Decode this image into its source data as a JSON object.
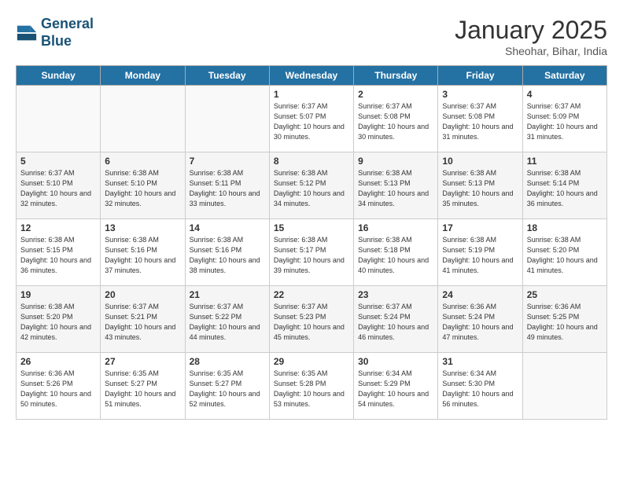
{
  "header": {
    "logo_line1": "General",
    "logo_line2": "Blue",
    "month": "January 2025",
    "location": "Sheohar, Bihar, India"
  },
  "days_of_week": [
    "Sunday",
    "Monday",
    "Tuesday",
    "Wednesday",
    "Thursday",
    "Friday",
    "Saturday"
  ],
  "weeks": [
    [
      {
        "day": "",
        "sunrise": "",
        "sunset": "",
        "daylight": ""
      },
      {
        "day": "",
        "sunrise": "",
        "sunset": "",
        "daylight": ""
      },
      {
        "day": "",
        "sunrise": "",
        "sunset": "",
        "daylight": ""
      },
      {
        "day": "1",
        "sunrise": "Sunrise: 6:37 AM",
        "sunset": "Sunset: 5:07 PM",
        "daylight": "Daylight: 10 hours and 30 minutes."
      },
      {
        "day": "2",
        "sunrise": "Sunrise: 6:37 AM",
        "sunset": "Sunset: 5:08 PM",
        "daylight": "Daylight: 10 hours and 30 minutes."
      },
      {
        "day": "3",
        "sunrise": "Sunrise: 6:37 AM",
        "sunset": "Sunset: 5:08 PM",
        "daylight": "Daylight: 10 hours and 31 minutes."
      },
      {
        "day": "4",
        "sunrise": "Sunrise: 6:37 AM",
        "sunset": "Sunset: 5:09 PM",
        "daylight": "Daylight: 10 hours and 31 minutes."
      }
    ],
    [
      {
        "day": "5",
        "sunrise": "Sunrise: 6:37 AM",
        "sunset": "Sunset: 5:10 PM",
        "daylight": "Daylight: 10 hours and 32 minutes."
      },
      {
        "day": "6",
        "sunrise": "Sunrise: 6:38 AM",
        "sunset": "Sunset: 5:10 PM",
        "daylight": "Daylight: 10 hours and 32 minutes."
      },
      {
        "day": "7",
        "sunrise": "Sunrise: 6:38 AM",
        "sunset": "Sunset: 5:11 PM",
        "daylight": "Daylight: 10 hours and 33 minutes."
      },
      {
        "day": "8",
        "sunrise": "Sunrise: 6:38 AM",
        "sunset": "Sunset: 5:12 PM",
        "daylight": "Daylight: 10 hours and 34 minutes."
      },
      {
        "day": "9",
        "sunrise": "Sunrise: 6:38 AM",
        "sunset": "Sunset: 5:13 PM",
        "daylight": "Daylight: 10 hours and 34 minutes."
      },
      {
        "day": "10",
        "sunrise": "Sunrise: 6:38 AM",
        "sunset": "Sunset: 5:13 PM",
        "daylight": "Daylight: 10 hours and 35 minutes."
      },
      {
        "day": "11",
        "sunrise": "Sunrise: 6:38 AM",
        "sunset": "Sunset: 5:14 PM",
        "daylight": "Daylight: 10 hours and 36 minutes."
      }
    ],
    [
      {
        "day": "12",
        "sunrise": "Sunrise: 6:38 AM",
        "sunset": "Sunset: 5:15 PM",
        "daylight": "Daylight: 10 hours and 36 minutes."
      },
      {
        "day": "13",
        "sunrise": "Sunrise: 6:38 AM",
        "sunset": "Sunset: 5:16 PM",
        "daylight": "Daylight: 10 hours and 37 minutes."
      },
      {
        "day": "14",
        "sunrise": "Sunrise: 6:38 AM",
        "sunset": "Sunset: 5:16 PM",
        "daylight": "Daylight: 10 hours and 38 minutes."
      },
      {
        "day": "15",
        "sunrise": "Sunrise: 6:38 AM",
        "sunset": "Sunset: 5:17 PM",
        "daylight": "Daylight: 10 hours and 39 minutes."
      },
      {
        "day": "16",
        "sunrise": "Sunrise: 6:38 AM",
        "sunset": "Sunset: 5:18 PM",
        "daylight": "Daylight: 10 hours and 40 minutes."
      },
      {
        "day": "17",
        "sunrise": "Sunrise: 6:38 AM",
        "sunset": "Sunset: 5:19 PM",
        "daylight": "Daylight: 10 hours and 41 minutes."
      },
      {
        "day": "18",
        "sunrise": "Sunrise: 6:38 AM",
        "sunset": "Sunset: 5:20 PM",
        "daylight": "Daylight: 10 hours and 41 minutes."
      }
    ],
    [
      {
        "day": "19",
        "sunrise": "Sunrise: 6:38 AM",
        "sunset": "Sunset: 5:20 PM",
        "daylight": "Daylight: 10 hours and 42 minutes."
      },
      {
        "day": "20",
        "sunrise": "Sunrise: 6:37 AM",
        "sunset": "Sunset: 5:21 PM",
        "daylight": "Daylight: 10 hours and 43 minutes."
      },
      {
        "day": "21",
        "sunrise": "Sunrise: 6:37 AM",
        "sunset": "Sunset: 5:22 PM",
        "daylight": "Daylight: 10 hours and 44 minutes."
      },
      {
        "day": "22",
        "sunrise": "Sunrise: 6:37 AM",
        "sunset": "Sunset: 5:23 PM",
        "daylight": "Daylight: 10 hours and 45 minutes."
      },
      {
        "day": "23",
        "sunrise": "Sunrise: 6:37 AM",
        "sunset": "Sunset: 5:24 PM",
        "daylight": "Daylight: 10 hours and 46 minutes."
      },
      {
        "day": "24",
        "sunrise": "Sunrise: 6:36 AM",
        "sunset": "Sunset: 5:24 PM",
        "daylight": "Daylight: 10 hours and 47 minutes."
      },
      {
        "day": "25",
        "sunrise": "Sunrise: 6:36 AM",
        "sunset": "Sunset: 5:25 PM",
        "daylight": "Daylight: 10 hours and 49 minutes."
      }
    ],
    [
      {
        "day": "26",
        "sunrise": "Sunrise: 6:36 AM",
        "sunset": "Sunset: 5:26 PM",
        "daylight": "Daylight: 10 hours and 50 minutes."
      },
      {
        "day": "27",
        "sunrise": "Sunrise: 6:35 AM",
        "sunset": "Sunset: 5:27 PM",
        "daylight": "Daylight: 10 hours and 51 minutes."
      },
      {
        "day": "28",
        "sunrise": "Sunrise: 6:35 AM",
        "sunset": "Sunset: 5:27 PM",
        "daylight": "Daylight: 10 hours and 52 minutes."
      },
      {
        "day": "29",
        "sunrise": "Sunrise: 6:35 AM",
        "sunset": "Sunset: 5:28 PM",
        "daylight": "Daylight: 10 hours and 53 minutes."
      },
      {
        "day": "30",
        "sunrise": "Sunrise: 6:34 AM",
        "sunset": "Sunset: 5:29 PM",
        "daylight": "Daylight: 10 hours and 54 minutes."
      },
      {
        "day": "31",
        "sunrise": "Sunrise: 6:34 AM",
        "sunset": "Sunset: 5:30 PM",
        "daylight": "Daylight: 10 hours and 56 minutes."
      },
      {
        "day": "",
        "sunrise": "",
        "sunset": "",
        "daylight": ""
      }
    ]
  ]
}
